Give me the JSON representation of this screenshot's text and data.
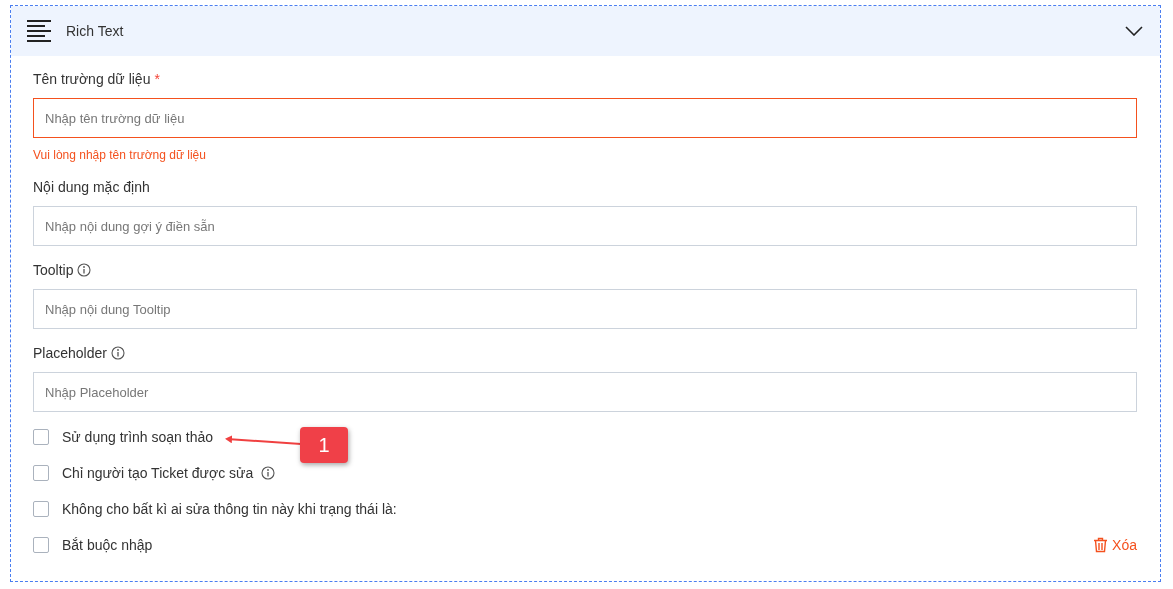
{
  "panel": {
    "title": "Rich Text",
    "expanded": true
  },
  "fields": [
    {
      "label": "Tên trường dữ liệu",
      "required": true,
      "info": false,
      "placeholder": "Nhập tên trường dữ liệu",
      "error": "Vui lòng nhập tên trường dữ liệu"
    },
    {
      "label": "Nội dung mặc định",
      "required": false,
      "info": false,
      "placeholder": "Nhập nội dung gợi ý điền sẵn"
    },
    {
      "label": "Tooltip",
      "required": false,
      "info": true,
      "placeholder": "Nhập nội dung Tooltip"
    },
    {
      "label": "Placeholder",
      "required": false,
      "info": true,
      "placeholder": "Nhập Placeholder"
    }
  ],
  "options": [
    {
      "label": "Sử dụng trình soạn thảo",
      "checked": false,
      "info": false
    },
    {
      "label": "Chỉ người tạo Ticket được sửa",
      "checked": false,
      "info": true
    },
    {
      "label": "Không cho bất kì ai sửa thông tin này khi trạng thái là:",
      "checked": false,
      "info": false
    },
    {
      "label": "Bắt buộc nhập",
      "checked": false,
      "info": false
    }
  ],
  "required_symbol": "*",
  "delete_button": {
    "label": "Xóa"
  },
  "callout": {
    "label": "1"
  }
}
